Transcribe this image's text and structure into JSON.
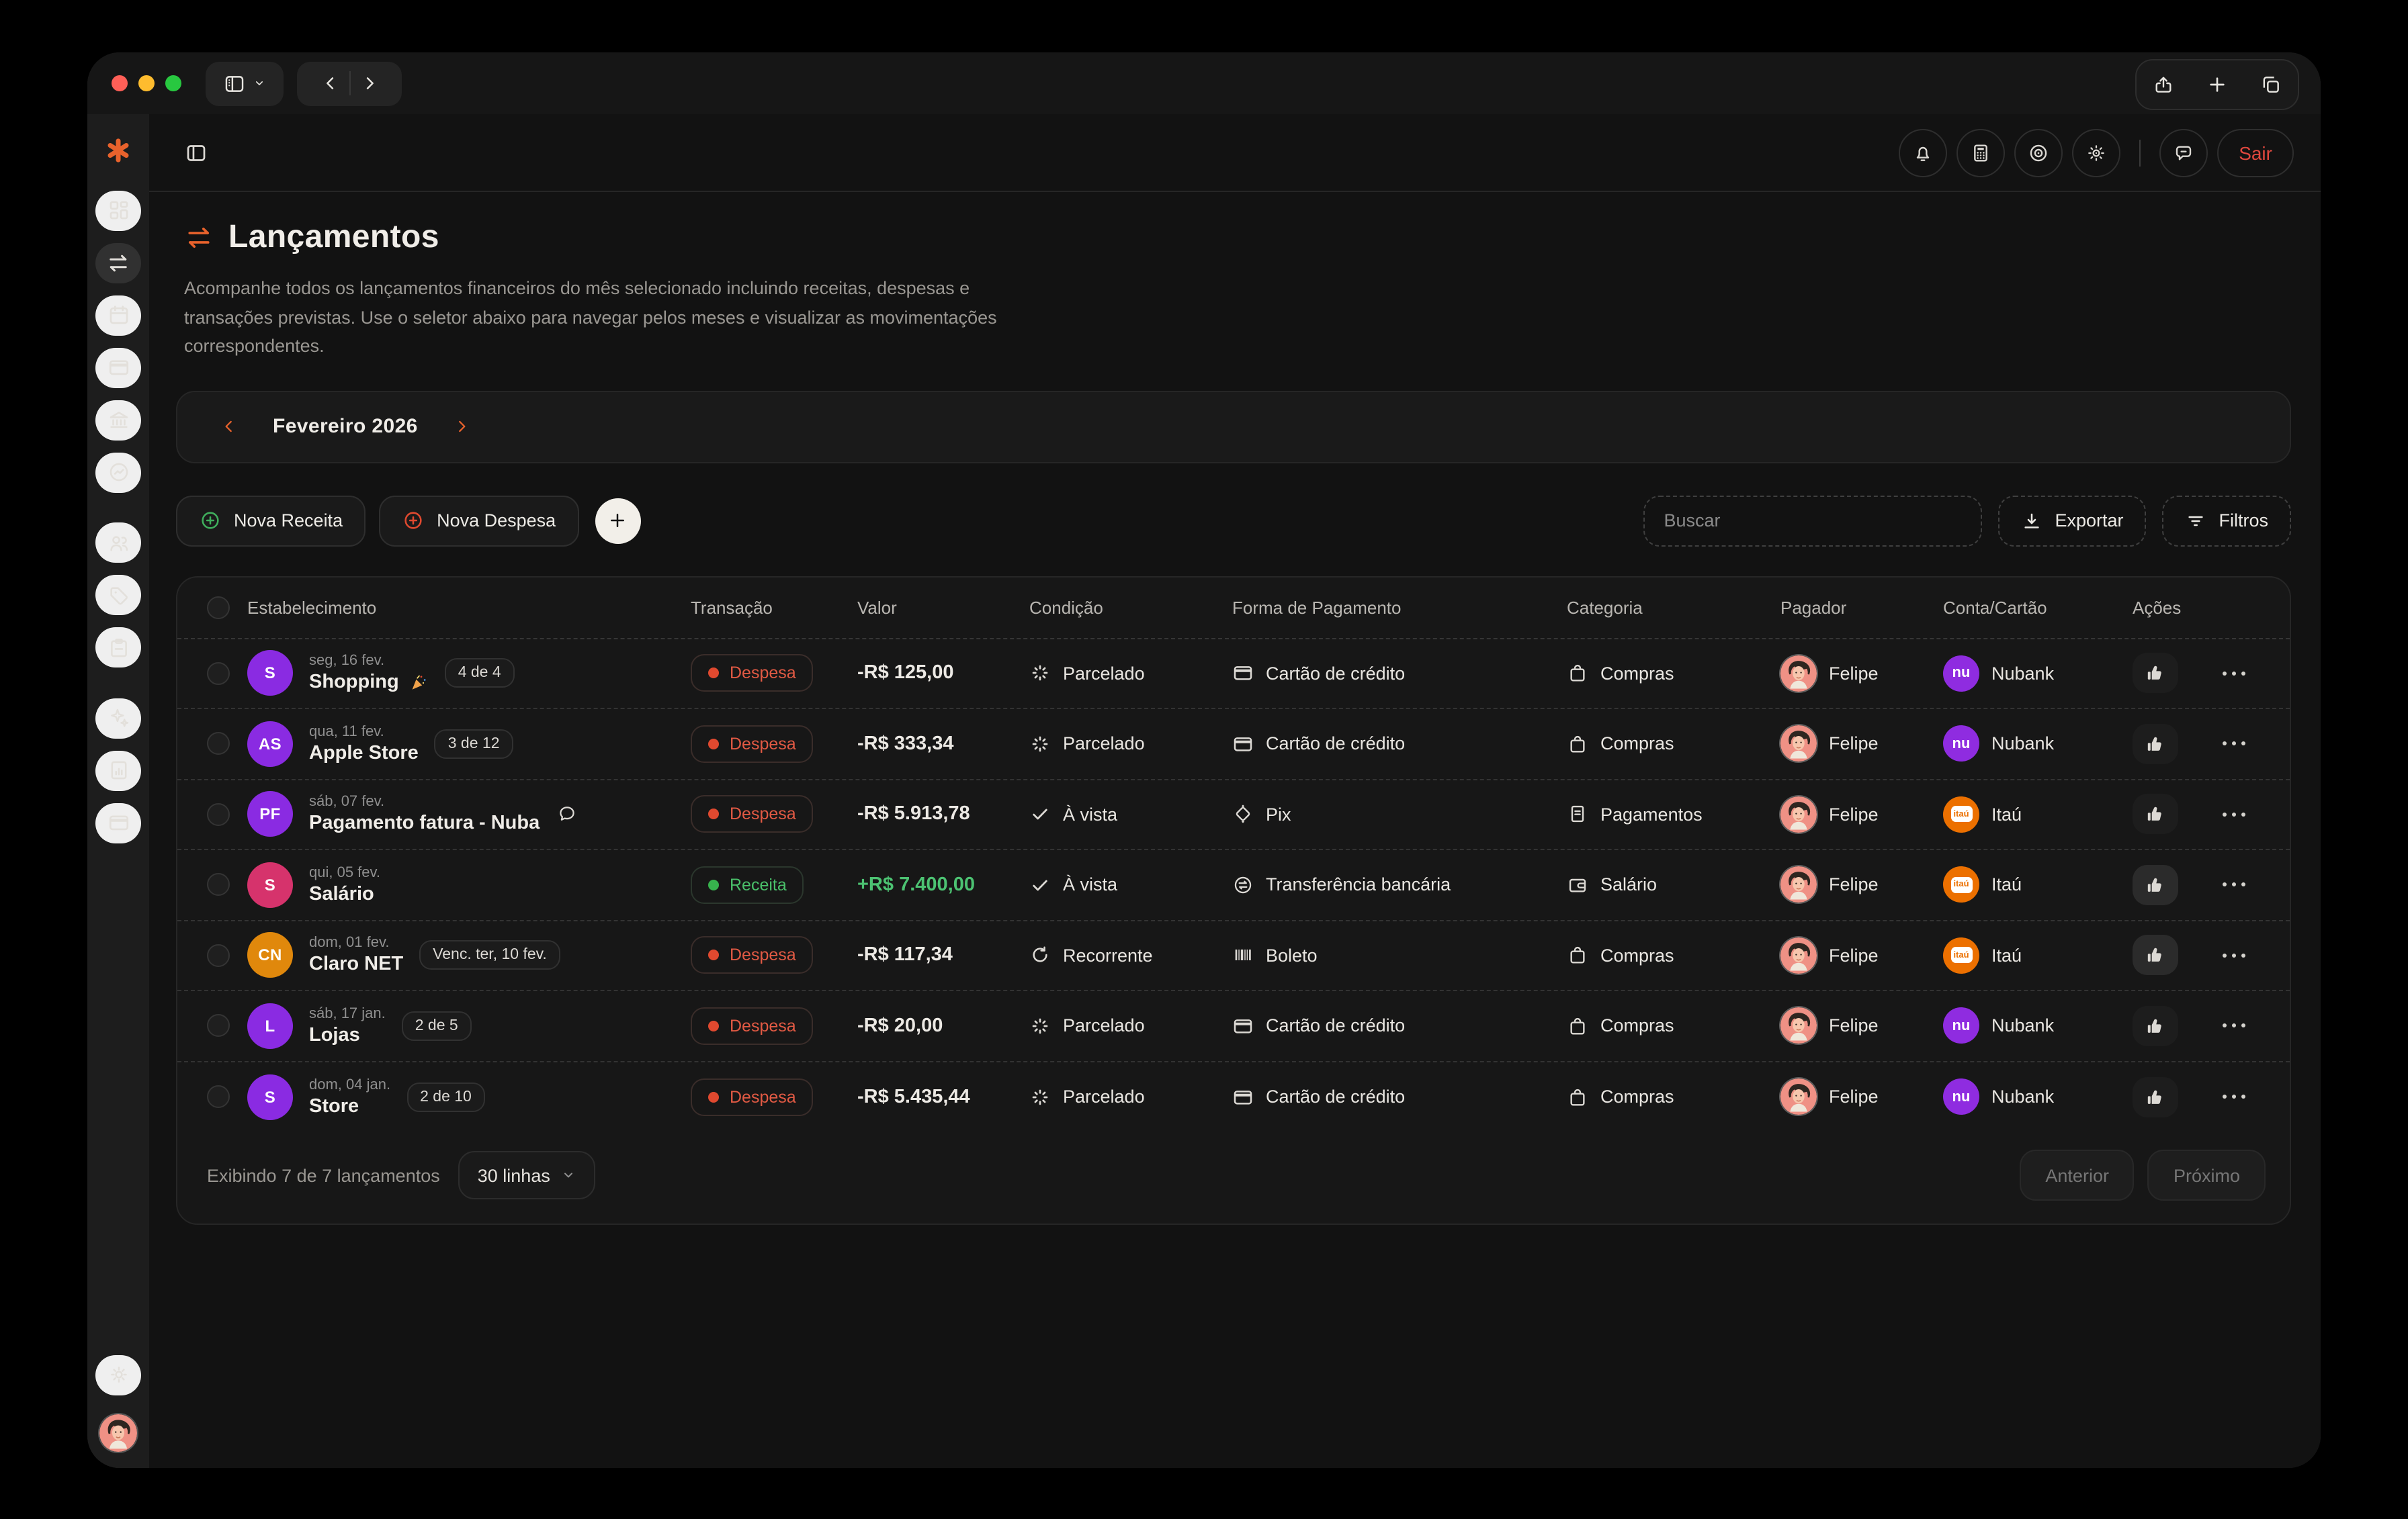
{
  "titlebar": {
    "traffic_lights": [
      "close",
      "minimize",
      "zoom"
    ],
    "icons": [
      "sidebar-toggle-icon",
      "chevron-down-icon",
      "back-icon",
      "forward-icon",
      "share-icon",
      "new-tab-icon",
      "copy-tabs-icon"
    ]
  },
  "header": {
    "icons": [
      "panel-toggle-icon",
      "bell-icon",
      "calculator-icon",
      "disc-icon",
      "sun-icon",
      "chat-icon"
    ],
    "sair_label": "Sair"
  },
  "sidebar": {
    "icons": [
      "logo-asterisk",
      "dashboard",
      "transactions",
      "calendar",
      "credit-card",
      "bank",
      "investments",
      "users",
      "tags",
      "clipboard",
      "ai-sparkles",
      "reports",
      "cards",
      "settings",
      "user-avatar"
    ],
    "active_item": "transactions"
  },
  "page": {
    "title": "Lançamentos",
    "description": "Acompanhe todos os lançamentos financeiros do mês selecionado incluindo receitas, despesas e transações previstas. Use o seletor abaixo para navegar pelos meses e visualizar as movimentações correspondentes."
  },
  "month": {
    "label": "Fevereiro 2026"
  },
  "toolbar": {
    "new_income": "Nova Receita",
    "new_expense": "Nova Despesa",
    "search_placeholder": "Buscar",
    "export_label": "Exportar",
    "filters_label": "Filtros"
  },
  "table": {
    "columns": [
      "Estabelecimento",
      "Transação",
      "Valor",
      "Condição",
      "Forma de Pagamento",
      "Categoria",
      "Pagador",
      "Conta/Cartão",
      "Ações"
    ],
    "rows": [
      {
        "initials": "S",
        "avatar_color": "#8a2be2",
        "date": "seg, 16 fev.",
        "name": "Shopping",
        "emoji": "party-popper",
        "badge": "4 de 4",
        "type": "Despesa",
        "value": "-R$ 125,00",
        "positive": false,
        "condition": "Parcelado",
        "payment": "Cartão de crédito",
        "category": "Compras",
        "payer": "Felipe",
        "account": "Nubank",
        "thumb_active": false
      },
      {
        "initials": "AS",
        "avatar_color": "#8a2be2",
        "date": "qua, 11 fev.",
        "name": "Apple Store",
        "badge": "3 de 12",
        "type": "Despesa",
        "value": "-R$ 333,34",
        "positive": false,
        "condition": "Parcelado",
        "payment": "Cartão de crédito",
        "category": "Compras",
        "payer": "Felipe",
        "account": "Nubank",
        "thumb_active": false
      },
      {
        "initials": "PF",
        "avatar_color": "#8a2be2",
        "date": "sáb, 07 fev.",
        "name": "Pagamento fatura - Nuba",
        "has_comment": true,
        "type": "Despesa",
        "value": "-R$ 5.913,78",
        "positive": false,
        "condition": "À vista",
        "payment": "Pix",
        "category": "Pagamentos",
        "payer": "Felipe",
        "account": "Itaú",
        "thumb_active": false
      },
      {
        "initials": "S",
        "avatar_color": "#d6336c",
        "date": "qui, 05 fev.",
        "name": "Salário",
        "type": "Receita",
        "value": "+R$ 7.400,00",
        "positive": true,
        "condition": "À vista",
        "payment": "Transferência bancária",
        "category": "Salário",
        "payer": "Felipe",
        "account": "Itaú",
        "thumb_active": true
      },
      {
        "initials": "CN",
        "avatar_color": "#e0880c",
        "date": "dom, 01 fev.",
        "name": "Claro NET",
        "badge": "Venc. ter, 10 fev.",
        "type": "Despesa",
        "value": "-R$ 117,34",
        "positive": false,
        "condition": "Recorrente",
        "payment": "Boleto",
        "category": "Compras",
        "payer": "Felipe",
        "account": "Itaú",
        "thumb_active": true
      },
      {
        "initials": "L",
        "avatar_color": "#8a2be2",
        "date": "sáb, 17 jan.",
        "name": "Lojas",
        "badge": "2 de 5",
        "type": "Despesa",
        "value": "-R$ 20,00",
        "positive": false,
        "condition": "Parcelado",
        "payment": "Cartão de crédito",
        "category": "Compras",
        "payer": "Felipe",
        "account": "Nubank",
        "thumb_active": false
      },
      {
        "initials": "S",
        "avatar_color": "#8a2be2",
        "date": "dom, 04 jan.",
        "name": "Store",
        "badge": "2 de 10",
        "type": "Despesa",
        "value": "-R$ 5.435,44",
        "positive": false,
        "condition": "Parcelado",
        "payment": "Cartão de crédito",
        "category": "Compras",
        "payer": "Felipe",
        "account": "Nubank",
        "thumb_active": false
      }
    ]
  },
  "footer": {
    "summary": "Exibindo 7 de 7 lançamentos",
    "rows_per_page": "30 linhas",
    "prev_label": "Anterior",
    "next_label": "Próximo"
  },
  "colors": {
    "accent_orange": "#e8622c",
    "expense_red": "#e0492f",
    "income_green": "#37b24d",
    "nubank_purple": "#8f2ce0",
    "itau_orange": "#ec7000",
    "sair_red": "#e0483e"
  }
}
